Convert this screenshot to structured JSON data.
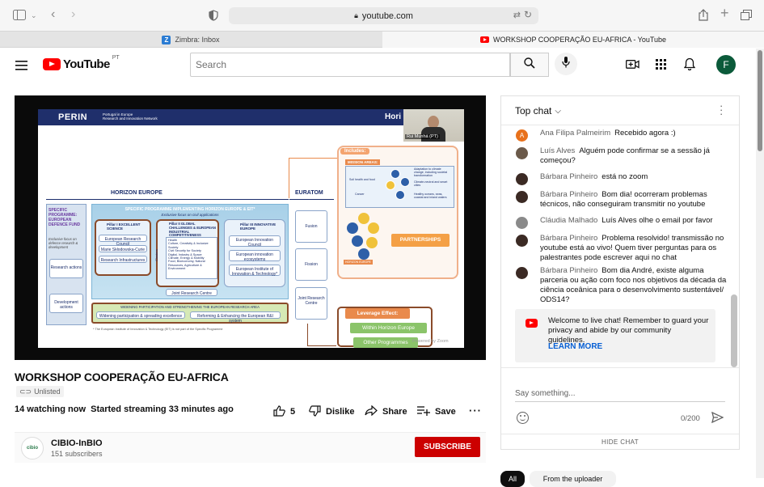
{
  "browser": {
    "url": "youtube.com",
    "tabs": [
      {
        "label": "Zimbra: Inbox",
        "icon": "zimbra-icon",
        "active": false
      },
      {
        "label": "WORKSHOP COOPERAÇÃO EU-AFRICA - YouTube",
        "icon": "youtube-icon",
        "active": true
      }
    ]
  },
  "header": {
    "logo_text": "YouTube",
    "region": "PT",
    "search_placeholder": "Search",
    "avatar_letter": "F"
  },
  "slide": {
    "brand": "PERIN",
    "brand_sub": "Portugal in Europe\nResearch and Innovation Network",
    "corner_title": "Hori",
    "presenter": "Rui Munhá (PT)",
    "horizon_title": "HORIZON EUROPE",
    "euratom_title": "EURATOM",
    "specific_programme": "SPECIFIC PROGRAMME: EUROPEAN DEFENCE FUND",
    "exclusive_focus": "Exclusive focus on defence research & development",
    "sp_title": "SPECIFIC PROGRAMME IMPLEMENTING HORIZON EUROPE & EIT*",
    "sp_sub": "Exclusive focus on civil applications",
    "pillar1": "Pillar I EXCELLENT SCIENCE",
    "pillar2": "Pillar II GLOBAL CHALLENGES & EUROPEAN INDUSTRIAL COMPETITIVENESS",
    "pillar3": "Pillar III INNOVATIVE EUROPE",
    "p1_items": [
      "European Research Council",
      "Marie Skłodowska-Curie",
      "Research Infrastructures"
    ],
    "p2_items": [
      "Health",
      "Culture, Creativity & Inclusive Society",
      "Civil Security for Society",
      "Digital, Industry & Space",
      "Climate, Energy & Mobility",
      "Food, Bioeconomy, Natural Resources, Agriculture & Environment"
    ],
    "p2_clusters": "Clusters",
    "jrc": "Joint Research Centre",
    "p3_items": [
      "European Innovation Council",
      "European innovation ecosystems",
      "European Institute of Innovation & Technology*"
    ],
    "research_actions": "Research actions",
    "development_actions": "Development actions",
    "fusion1": "Fusion",
    "fission": "Fission",
    "euratom_jrc": "Joint Research Centre",
    "widening": "WIDENING PARTICIPATION AND STRENGTHENING THE EUROPEAN RESEARCH AREA",
    "widening_a": "Widening participation & spreading excellence",
    "widening_b": "Reforming & Enhancing the European R&I system",
    "footnote": "* The European Institute of Innovation & Technology (EIT) is not part of the Specific Programme",
    "includes": "Includes:",
    "mission_areas": "MISSION AREAS:",
    "missions": [
      "Adaptation to climate change, including societal transformation",
      "Soil health and food",
      "Climate-neutral and smart cities",
      "Cancer",
      "Healthy oceans, seas, coastal and inland waters"
    ],
    "partnerships": "PARTNERSHIPS",
    "horizon_europe_badge": "HORIZON EUROPE",
    "leverage": "Leverage Effect:",
    "within": "Within Horizon Europe",
    "other": "Other Programmes",
    "powered": "Powered by Zoom"
  },
  "video": {
    "title": "WORKSHOP COOPERAÇÃO EU-AFRICA",
    "visibility": "Unlisted",
    "stats": "14 watching now  Started streaming 33 minutes ago",
    "likes": "5",
    "dislike": "Dislike",
    "share": "Share",
    "save": "Save"
  },
  "channel": {
    "name": "CIBIO-InBIO",
    "subscribers": "151 subscribers",
    "logo_text": "cibio",
    "subscribe": "SUBSCRIBE"
  },
  "chat": {
    "mode": "Top chat",
    "messages": [
      {
        "author": "Ana Filipa Palmeirim",
        "text": "Recebido agora :)",
        "avatar_color": "#e8711c",
        "avatar_letter": "A"
      },
      {
        "author": "Luís Alves",
        "text": "Alguém pode confirmar se a sessão já começou?",
        "avatar_color": "#6b5a4a",
        "avatar_letter": ""
      },
      {
        "author": "Bárbara Pinheiro",
        "text": "está no zoom",
        "avatar_color": "#3b2a24",
        "avatar_letter": ""
      },
      {
        "author": "Bárbara Pinheiro",
        "text": "Bom dia! ocorreram problemas técnicos, não conseguiram transmitir no youtube",
        "avatar_color": "#3b2a24",
        "avatar_letter": ""
      },
      {
        "author": "Cláudia Malhado",
        "text": "Luís Alves olhe o email por favor",
        "avatar_color": "#8a8a8a",
        "avatar_letter": ""
      },
      {
        "author": "Bárbara Pinheiro",
        "text": "Problema resolvido! transmissão no youtube está ao vivo! Quem tiver perguntas para os palestrantes pode escrever aqui no chat",
        "avatar_color": "#3b2a24",
        "avatar_letter": ""
      },
      {
        "author": "Bárbara Pinheiro",
        "text": "Bom dia André, existe alguma parceria ou ação com foco nos objetivos da década da ciência oceânica para o desenvolvimento sustentável/ ODS14?",
        "avatar_color": "#3b2a24",
        "avatar_letter": ""
      }
    ],
    "notice": "Welcome to live chat! Remember to guard your privacy and abide by our community guidelines.",
    "learn_more": "LEARN MORE",
    "input_placeholder": "Say something...",
    "counter": "0/200",
    "hide": "HIDE CHAT"
  },
  "chips": {
    "all": "All",
    "next": "From the uploader"
  },
  "colors": {
    "youtube_red": "#ff0000",
    "subscribe_red": "#cc0000",
    "link_blue": "#065fd4",
    "avatar_green": "#0b5a3a"
  }
}
